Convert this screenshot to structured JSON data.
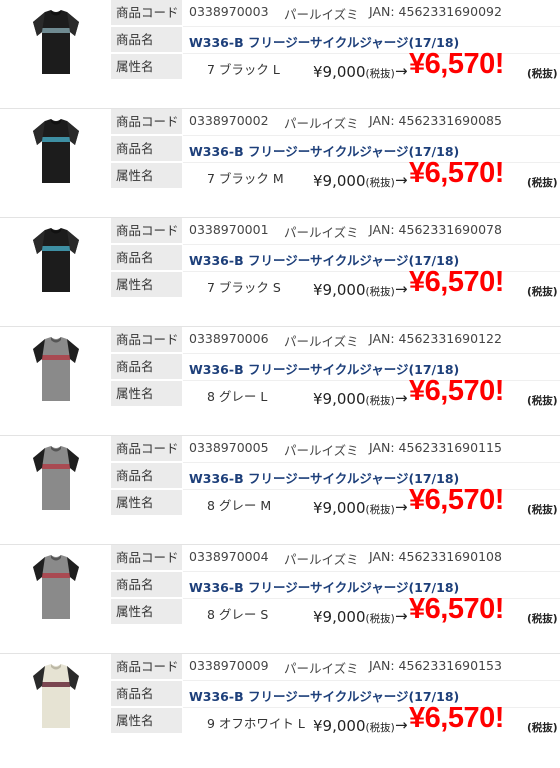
{
  "labels": {
    "code": "商品コード",
    "name": "商品名",
    "attr": "属性名"
  },
  "price": {
    "original": "¥9,000",
    "tax_note": "(税抜)",
    "arrow": "→",
    "sale": "¥6,570!",
    "sale_tax_note": "(税抜)"
  },
  "items": [
    {
      "code": "0338970003",
      "maker": "パールイズミ",
      "jan": "JAN: 4562331690092",
      "name": "W336-B フリージーサイクルジャージ(17/18)",
      "attr": "7 ブラック L",
      "color": "black",
      "stripe": "#6f8a91"
    },
    {
      "code": "0338970002",
      "maker": "パールイズミ",
      "jan": "JAN: 4562331690085",
      "name": "W336-B フリージーサイクルジャージ(17/18)",
      "attr": "7 ブラック M",
      "color": "black",
      "stripe": "#3e8fa3"
    },
    {
      "code": "0338970001",
      "maker": "パールイズミ",
      "jan": "JAN: 4562331690078",
      "name": "W336-B フリージーサイクルジャージ(17/18)",
      "attr": "7 ブラック S",
      "color": "black",
      "stripe": "#3e8fa3"
    },
    {
      "code": "0338970006",
      "maker": "パールイズミ",
      "jan": "JAN: 4562331690122",
      "name": "W336-B フリージーサイクルジャージ(17/18)",
      "attr": "8 グレー L",
      "color": "gray",
      "stripe": "#a94a52"
    },
    {
      "code": "0338970005",
      "maker": "パールイズミ",
      "jan": "JAN: 4562331690115",
      "name": "W336-B フリージーサイクルジャージ(17/18)",
      "attr": "8 グレー M",
      "color": "gray",
      "stripe": "#a94a52"
    },
    {
      "code": "0338970004",
      "maker": "パールイズミ",
      "jan": "JAN: 4562331690108",
      "name": "W336-B フリージーサイクルジャージ(17/18)",
      "attr": "8 グレー S",
      "color": "gray",
      "stripe": "#a94a52"
    },
    {
      "code": "0338970009",
      "maker": "パールイズミ",
      "jan": "JAN: 4562331690153",
      "name": "W336-B フリージーサイクルジャージ(17/18)",
      "attr": "9 オフホワイト L",
      "color": "offwhite",
      "stripe": "#7a4650"
    }
  ],
  "icons": {
    "thumbnail": "jersey-icon"
  }
}
